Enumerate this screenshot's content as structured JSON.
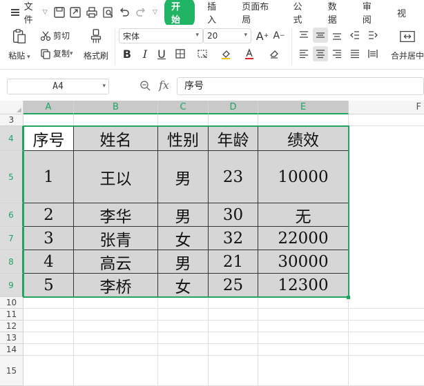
{
  "menu": {
    "file": "文件",
    "tabs": [
      {
        "label": "开始",
        "active": true
      },
      {
        "label": "插入",
        "active": false
      },
      {
        "label": "页面布局",
        "active": false
      },
      {
        "label": "公式",
        "active": false
      },
      {
        "label": "数据",
        "active": false
      },
      {
        "label": "审阅",
        "active": false
      },
      {
        "label": "视",
        "active": false
      }
    ]
  },
  "ribbon": {
    "paste": "粘贴",
    "cut": "剪切",
    "copy": "复制",
    "format_painter": "格式刷",
    "font_name": "宋体",
    "font_size": "20",
    "merge_center": "合并居中"
  },
  "formula_bar": {
    "name_box": "A4",
    "fx": "fx",
    "formula": "序号"
  },
  "sheet": {
    "columns": [
      "A",
      "B",
      "C",
      "D",
      "E",
      "F"
    ],
    "rows": [
      "3",
      "4",
      "5",
      "6",
      "7",
      "8",
      "9",
      "10",
      "11",
      "12",
      "13",
      "14",
      "15"
    ],
    "table": [
      [
        "序号",
        "姓名",
        "性别",
        "年龄",
        "绩效"
      ],
      [
        "1",
        "王以",
        "男",
        "23",
        "10000"
      ],
      [
        "2",
        "李华",
        "男",
        "30",
        "无"
      ],
      [
        "3",
        "张青",
        "女",
        "32",
        "22000"
      ],
      [
        "4",
        "高云",
        "男",
        "21",
        "30000"
      ],
      [
        "5",
        "李桥",
        "女",
        "25",
        "12300"
      ]
    ]
  },
  "colors": {
    "accent": "#20b464",
    "selection": "#20a462",
    "cell_fill": "#d6d6d6"
  }
}
